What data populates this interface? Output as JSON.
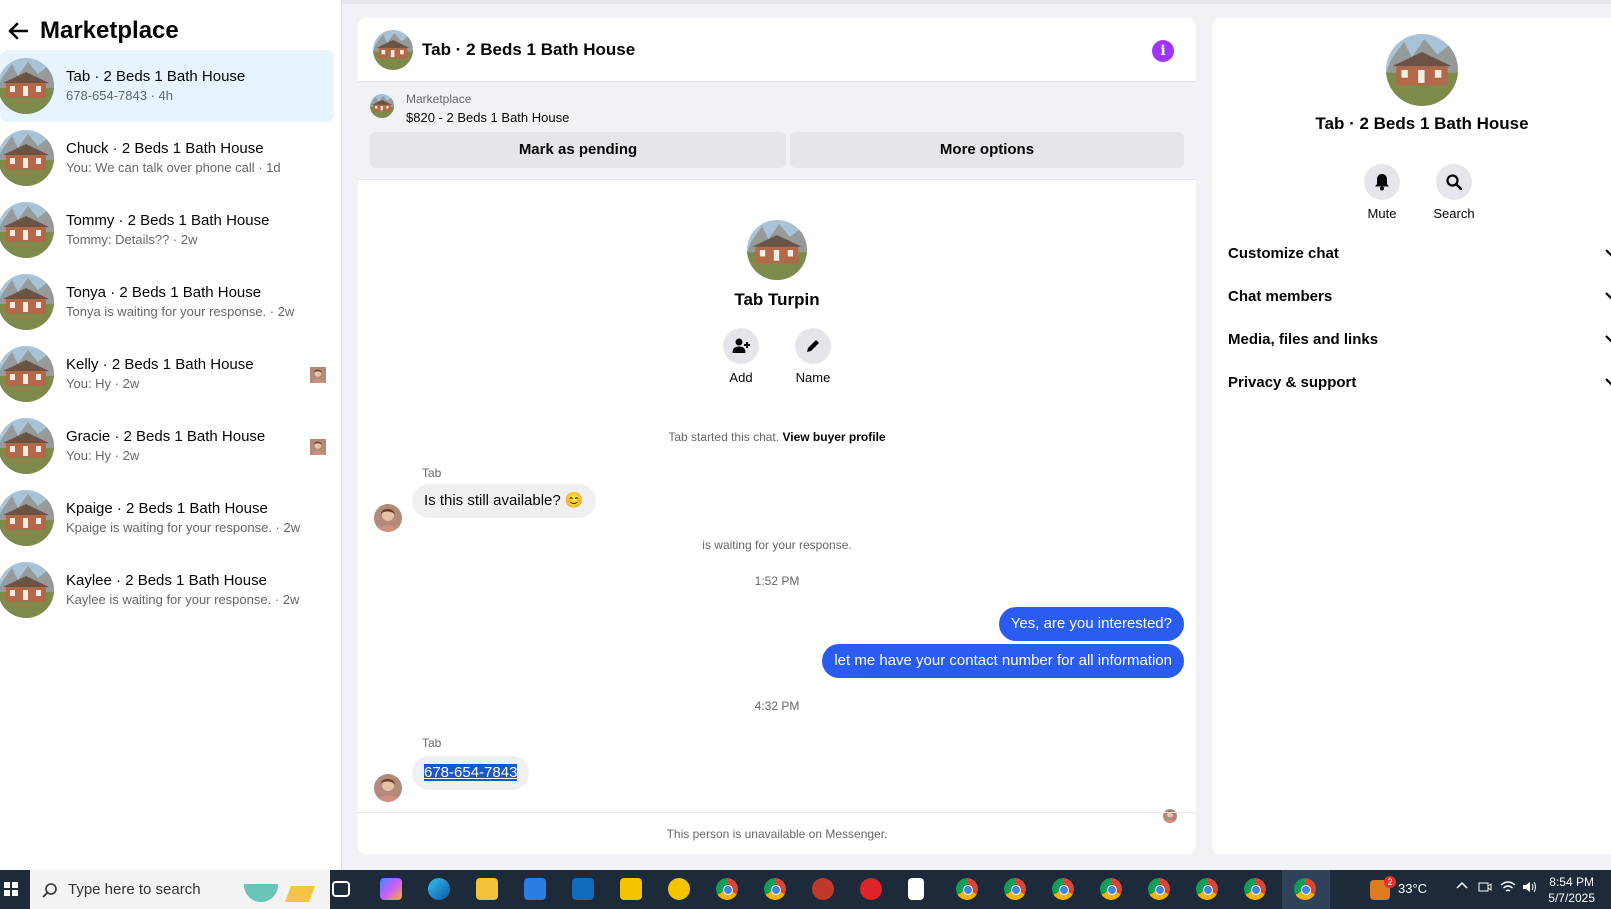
{
  "sidebar": {
    "title": "Marketplace",
    "conversations": [
      {
        "name": "Tab · 2 Beds 1 Bath House",
        "sub": "678-654-7843 · 4h"
      },
      {
        "name": "Chuck · 2 Beds 1 Bath House",
        "sub": "You: We can talk over phone call · 1d"
      },
      {
        "name": "Tommy · 2 Beds 1 Bath House",
        "sub": "Tommy: Details?? · 2w"
      },
      {
        "name": "Tonya · 2 Beds 1 Bath House",
        "sub": "Tonya is waiting for your response. · 2w"
      },
      {
        "name": "Kelly · 2 Beds 1 Bath House",
        "sub": "You: Hy · 2w"
      },
      {
        "name": "Gracie · 2 Beds 1 Bath House",
        "sub": "You: Hy · 2w"
      },
      {
        "name": "Kpaige · 2 Beds 1 Bath House",
        "sub": "Kpaige is waiting for your response. · 2w"
      },
      {
        "name": "Kaylee · 2 Beds 1 Bath House",
        "sub": "Kaylee is waiting for your response. · 2w"
      }
    ]
  },
  "chat": {
    "title": "Tab · 2 Beds 1 Bath House",
    "marketplace_label": "Marketplace",
    "listing": "$820 - 2 Beds 1 Bath House",
    "mark_pending": "Mark as pending",
    "more_options": "More options",
    "person_name": "Tab Turpin",
    "add_label": "Add",
    "name_label": "Name",
    "started_text": "Tab started this chat.",
    "view_buyer": "View buyer profile",
    "sender1": "Tab",
    "msg1": "Is this still available? 😊",
    "waiting": "is waiting for your response.",
    "time1": "1:52 PM",
    "out1": "Yes, are you interested?",
    "out2": "let me have your contact number for all information",
    "time2": "4:32 PM",
    "sender2": "Tab",
    "msg2": "678-654-7843",
    "footer": "This person is unavailable on Messenger."
  },
  "details": {
    "name": "Tab · 2 Beds 1 Bath House",
    "mute": "Mute",
    "search": "Search",
    "rows": [
      "Customize chat",
      "Chat members",
      "Media, files and links",
      "Privacy & support"
    ]
  },
  "taskbar": {
    "search_placeholder": "Type here to search",
    "temperature": "33°C",
    "time": "8:54 PM",
    "date": "5/7/2025",
    "notif_count": "2"
  },
  "colors": {
    "accent": "#0866ff",
    "outgoing": "#2b5cf0",
    "info": "#a033ff"
  }
}
